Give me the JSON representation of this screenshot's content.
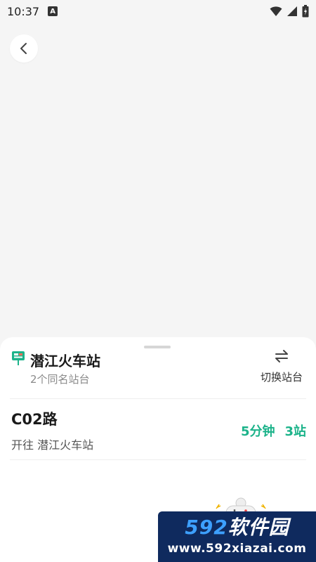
{
  "status_bar": {
    "time": "10:37",
    "notification_badge": "A"
  },
  "station": {
    "name": "潜江火车站",
    "subtitle": "2个同名站台",
    "switch_label": "切换站台"
  },
  "routes": [
    {
      "name": "C02路",
      "destination": "开往 潜江火车站",
      "eta_minutes": "5分钟",
      "eta_stops": "3站"
    }
  ],
  "watermark": {
    "logo_numbers": "592",
    "logo_text": "软件园",
    "url": "www.592xiazai.com"
  },
  "colors": {
    "accent": "#1cb38a",
    "background": "#f5f5f5",
    "sheet": "#ffffff",
    "station_icon": "#1cb38a"
  },
  "icons": [
    "back-arrow-icon",
    "station-sign-icon",
    "switch-arrows-icon",
    "wifi-icon",
    "signal-icon",
    "battery-icon",
    "gamepad-icon"
  ]
}
